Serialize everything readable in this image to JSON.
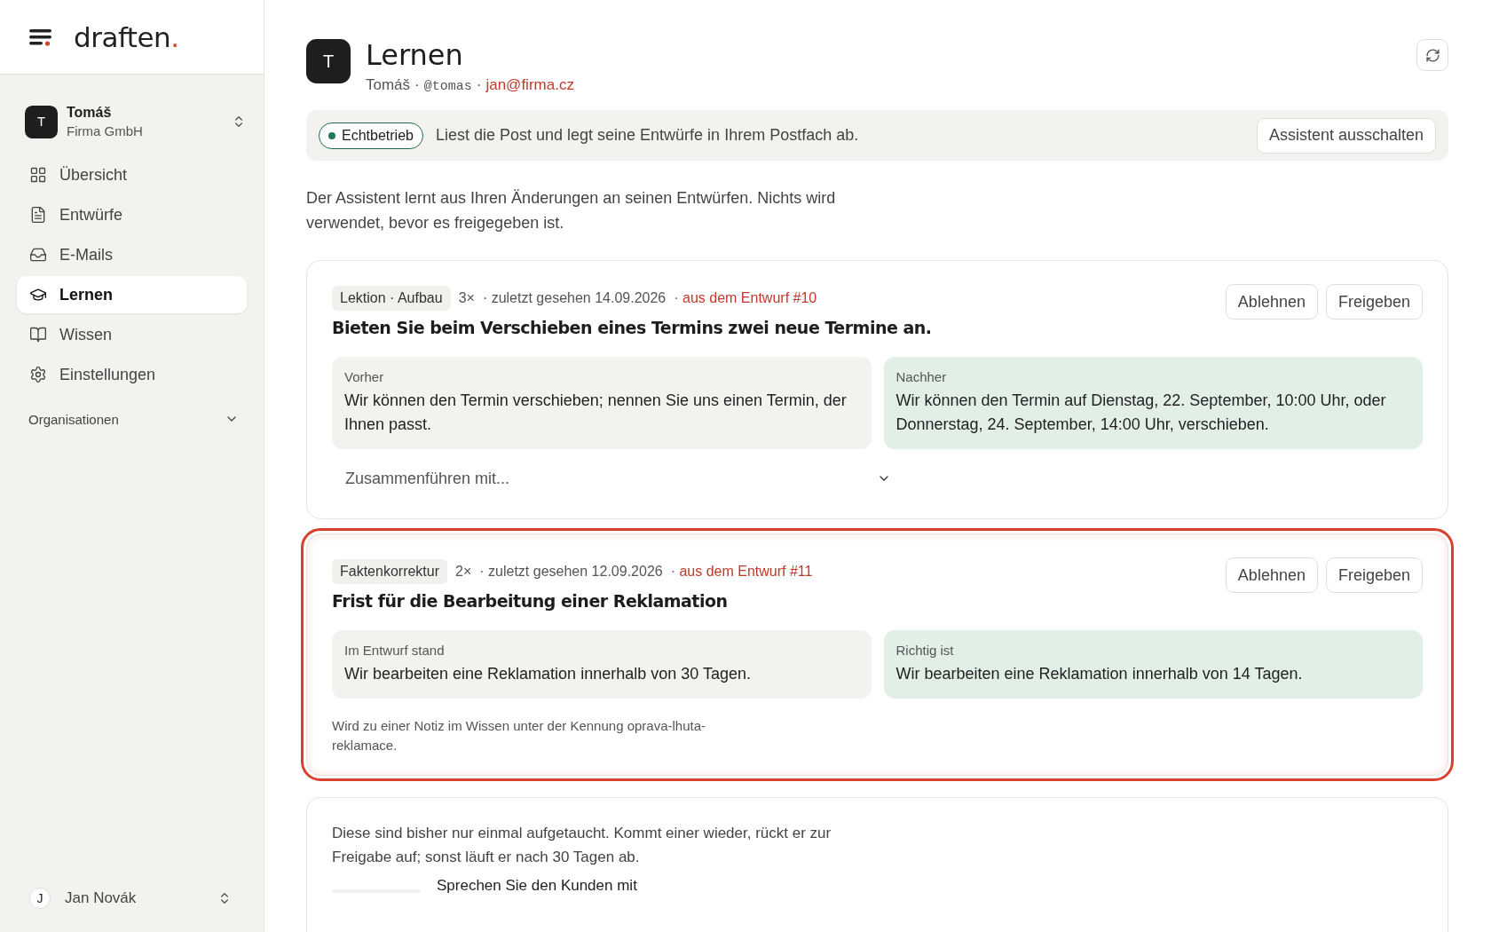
{
  "sidebar": {
    "logo": "draften",
    "logo_dot": ".",
    "workspace": {
      "initial": "T",
      "name": "Tomáš",
      "org": "Firma GmbH"
    },
    "nav": [
      {
        "label": "Übersicht",
        "selected": false
      },
      {
        "label": "Entwürfe",
        "selected": false
      },
      {
        "label": "E-Mails",
        "selected": false
      },
      {
        "label": "Lernen",
        "selected": true
      },
      {
        "label": "Wissen",
        "selected": false
      },
      {
        "label": "Einstellungen",
        "selected": false
      }
    ],
    "section": {
      "label": "Organisationen",
      "expanded": false
    },
    "user": {
      "initial": "J",
      "name": "Jan Novák"
    }
  },
  "header": {
    "initial": "T",
    "title": "Lernen",
    "name": "Tomáš",
    "separators": [
      "·",
      "·"
    ],
    "handle": "@tomas",
    "email": "jan@firma.cz"
  },
  "status": {
    "badge": "Echtbetrieb",
    "text": "Liest die Post und legt seine Entwürfe in Ihrem Postfach ab.",
    "button": "Assistent ausschalten"
  },
  "intro": "Der Assistent lernt aus Ihren Änderungen an seinen Entwürfen. Nichts wird verwendet, bevor es freigegeben ist.",
  "lessons": [
    {
      "tag": "Lektion · Aufbau",
      "count": "3×",
      "seen": "· zuletzt gesehen 14.09.2026",
      "source": "· aus dem Entwurf #10",
      "highlighted": false,
      "title": "Bieten Sie beim Verschieben eines Termins zwei neue Termine an.",
      "before_label": "Vorher",
      "before": "Wir können den Termin verschieben; nennen Sie uns einen Termin, der Ihnen passt.",
      "after_label": "Nachher",
      "after": "Wir können den Termin auf Dienstag, 22. September, 10:00 Uhr, oder Donnerstag, 24. September, 14:00 Uhr, verschieben.",
      "merge_placeholder": "Zusammenführen mit...",
      "actions": [
        "Ablehnen",
        "Freigeben"
      ]
    },
    {
      "tag": "Faktenkorrektur",
      "count": "2×",
      "seen": "· zuletzt gesehen 12.09.2026",
      "source": "· aus dem Entwurf #11",
      "highlighted": true,
      "title": "Frist für die Bearbeitung einer Reklamation",
      "before_label": "Im Entwurf stand",
      "before": "Wir bearbeiten eine Reklamation innerhalb von 30 Tagen.",
      "after_label": "Richtig ist",
      "after": "Wir bearbeiten eine Reklamation innerhalb von 14 Tagen.",
      "note": "Wird zu einer Notiz im Wissen unter der Kennung oprava-lhuta-reklamace.",
      "actions": [
        "Ablehnen",
        "Freigeben"
      ]
    }
  ],
  "pending": {
    "text": "Diese sind bisher nur einmal aufgetaucht. Kommt einer wieder, rückt er zur Freigabe auf; sonst läuft er nach 30 Tagen ab.",
    "first_item": "Sprechen Sie den Kunden mit"
  }
}
